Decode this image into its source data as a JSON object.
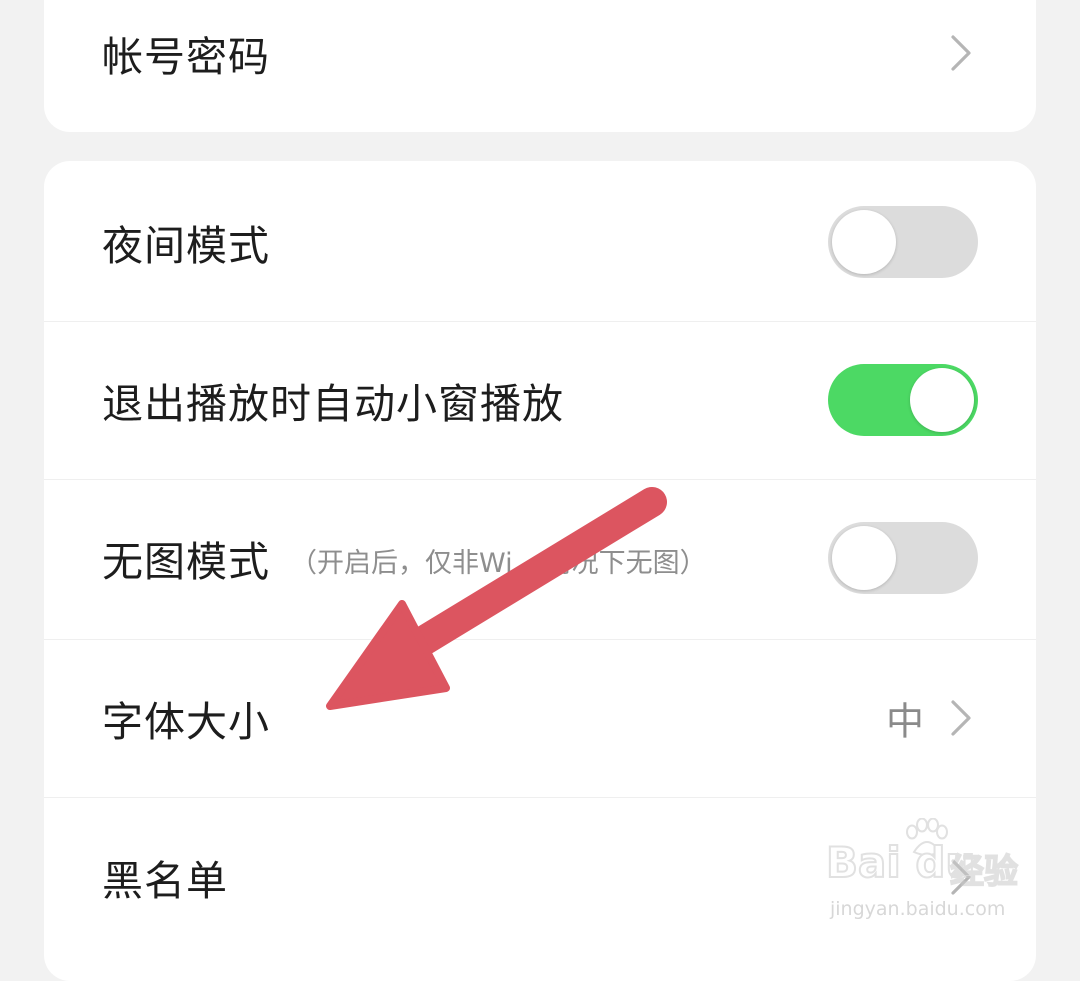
{
  "account_card": {
    "account_password": {
      "label": "帐号密码",
      "icon": "chevron-right-icon"
    }
  },
  "settings_card": {
    "night_mode": {
      "label": "夜间模式",
      "toggle_on": false
    },
    "pip_on_exit": {
      "label": "退出播放时自动小窗播放",
      "toggle_on": true
    },
    "no_image_mode": {
      "label": "无图模式",
      "hint": "（开启后，仅非Wi",
      "hint_tail": "情况下无图）",
      "toggle_on": false
    },
    "font_size": {
      "label": "字体大小",
      "value": "中",
      "icon": "chevron-right-icon"
    },
    "blacklist": {
      "label": "黑名单",
      "icon": "chevron-right-icon"
    }
  },
  "annotation": {
    "arrow_color": "#dc5560",
    "points_to": "字体大小"
  },
  "watermark": {
    "brand": "Bai du",
    "brand_cn": "经验",
    "url": "jingyan.baidu.com"
  },
  "colors": {
    "background": "#f2f2f2",
    "card": "#ffffff",
    "toggle_on": "#4cd964",
    "toggle_off": "#dcdcdc"
  }
}
